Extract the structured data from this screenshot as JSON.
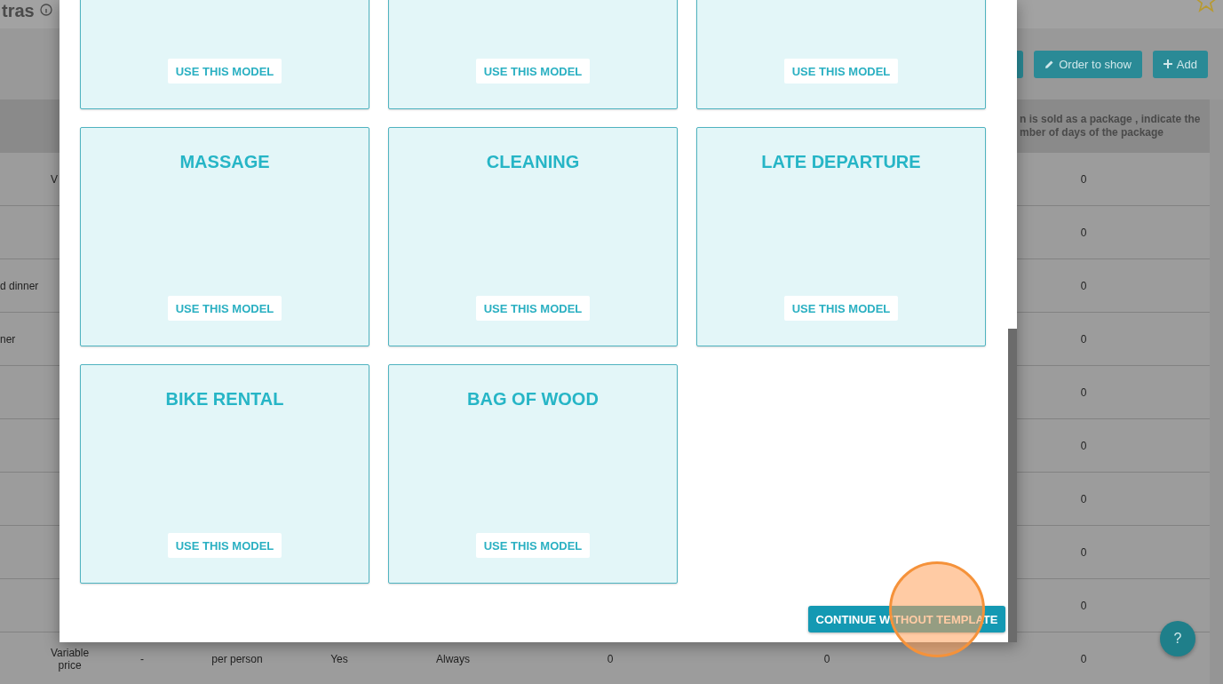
{
  "page": {
    "title": "tras",
    "toolbar_buttons": [
      {
        "label": "Order to show",
        "kind": "pencil"
      },
      {
        "label": "Add",
        "kind": "plus"
      }
    ],
    "table": {
      "header_lines": [
        "n is sold as a package , indicate the",
        "mber of days of the package"
      ],
      "rows": [
        {
          "price": "V",
          "package_days": "0"
        },
        {
          "package_days": "0"
        },
        {
          "name": "d dinner",
          "package_days": "0"
        },
        {
          "name": "ner",
          "package_days": "0"
        },
        {
          "package_days": "0"
        },
        {
          "package_days": "0"
        },
        {
          "package_days": "0"
        },
        {
          "package_days": "0"
        },
        {
          "package_days": "0"
        },
        {
          "price": "Variable price",
          "column_3": "-",
          "column_4": "per person",
          "column_5": "Yes",
          "column_6": "Always",
          "column_7": "0",
          "column_8": "0",
          "package_days": "0"
        }
      ]
    },
    "help_button": "?"
  },
  "modal": {
    "cards": [
      {
        "button": "USE THIS MODEL"
      },
      {
        "button": "USE THIS MODEL"
      },
      {
        "button": "USE THIS MODEL"
      },
      {
        "title": "MASSAGE",
        "button": "USE THIS MODEL"
      },
      {
        "title": "CLEANING",
        "button": "USE THIS MODEL"
      },
      {
        "title": "LATE DEPARTURE",
        "button": "USE THIS MODEL"
      },
      {
        "title": "BIKE RENTAL",
        "button": "USE THIS MODEL"
      },
      {
        "title": "BAG OF WOOD",
        "button": "USE THIS MODEL"
      }
    ],
    "continue_button": "CONTINUE WITHOUT TEMPLATE"
  },
  "click_marker": true
}
